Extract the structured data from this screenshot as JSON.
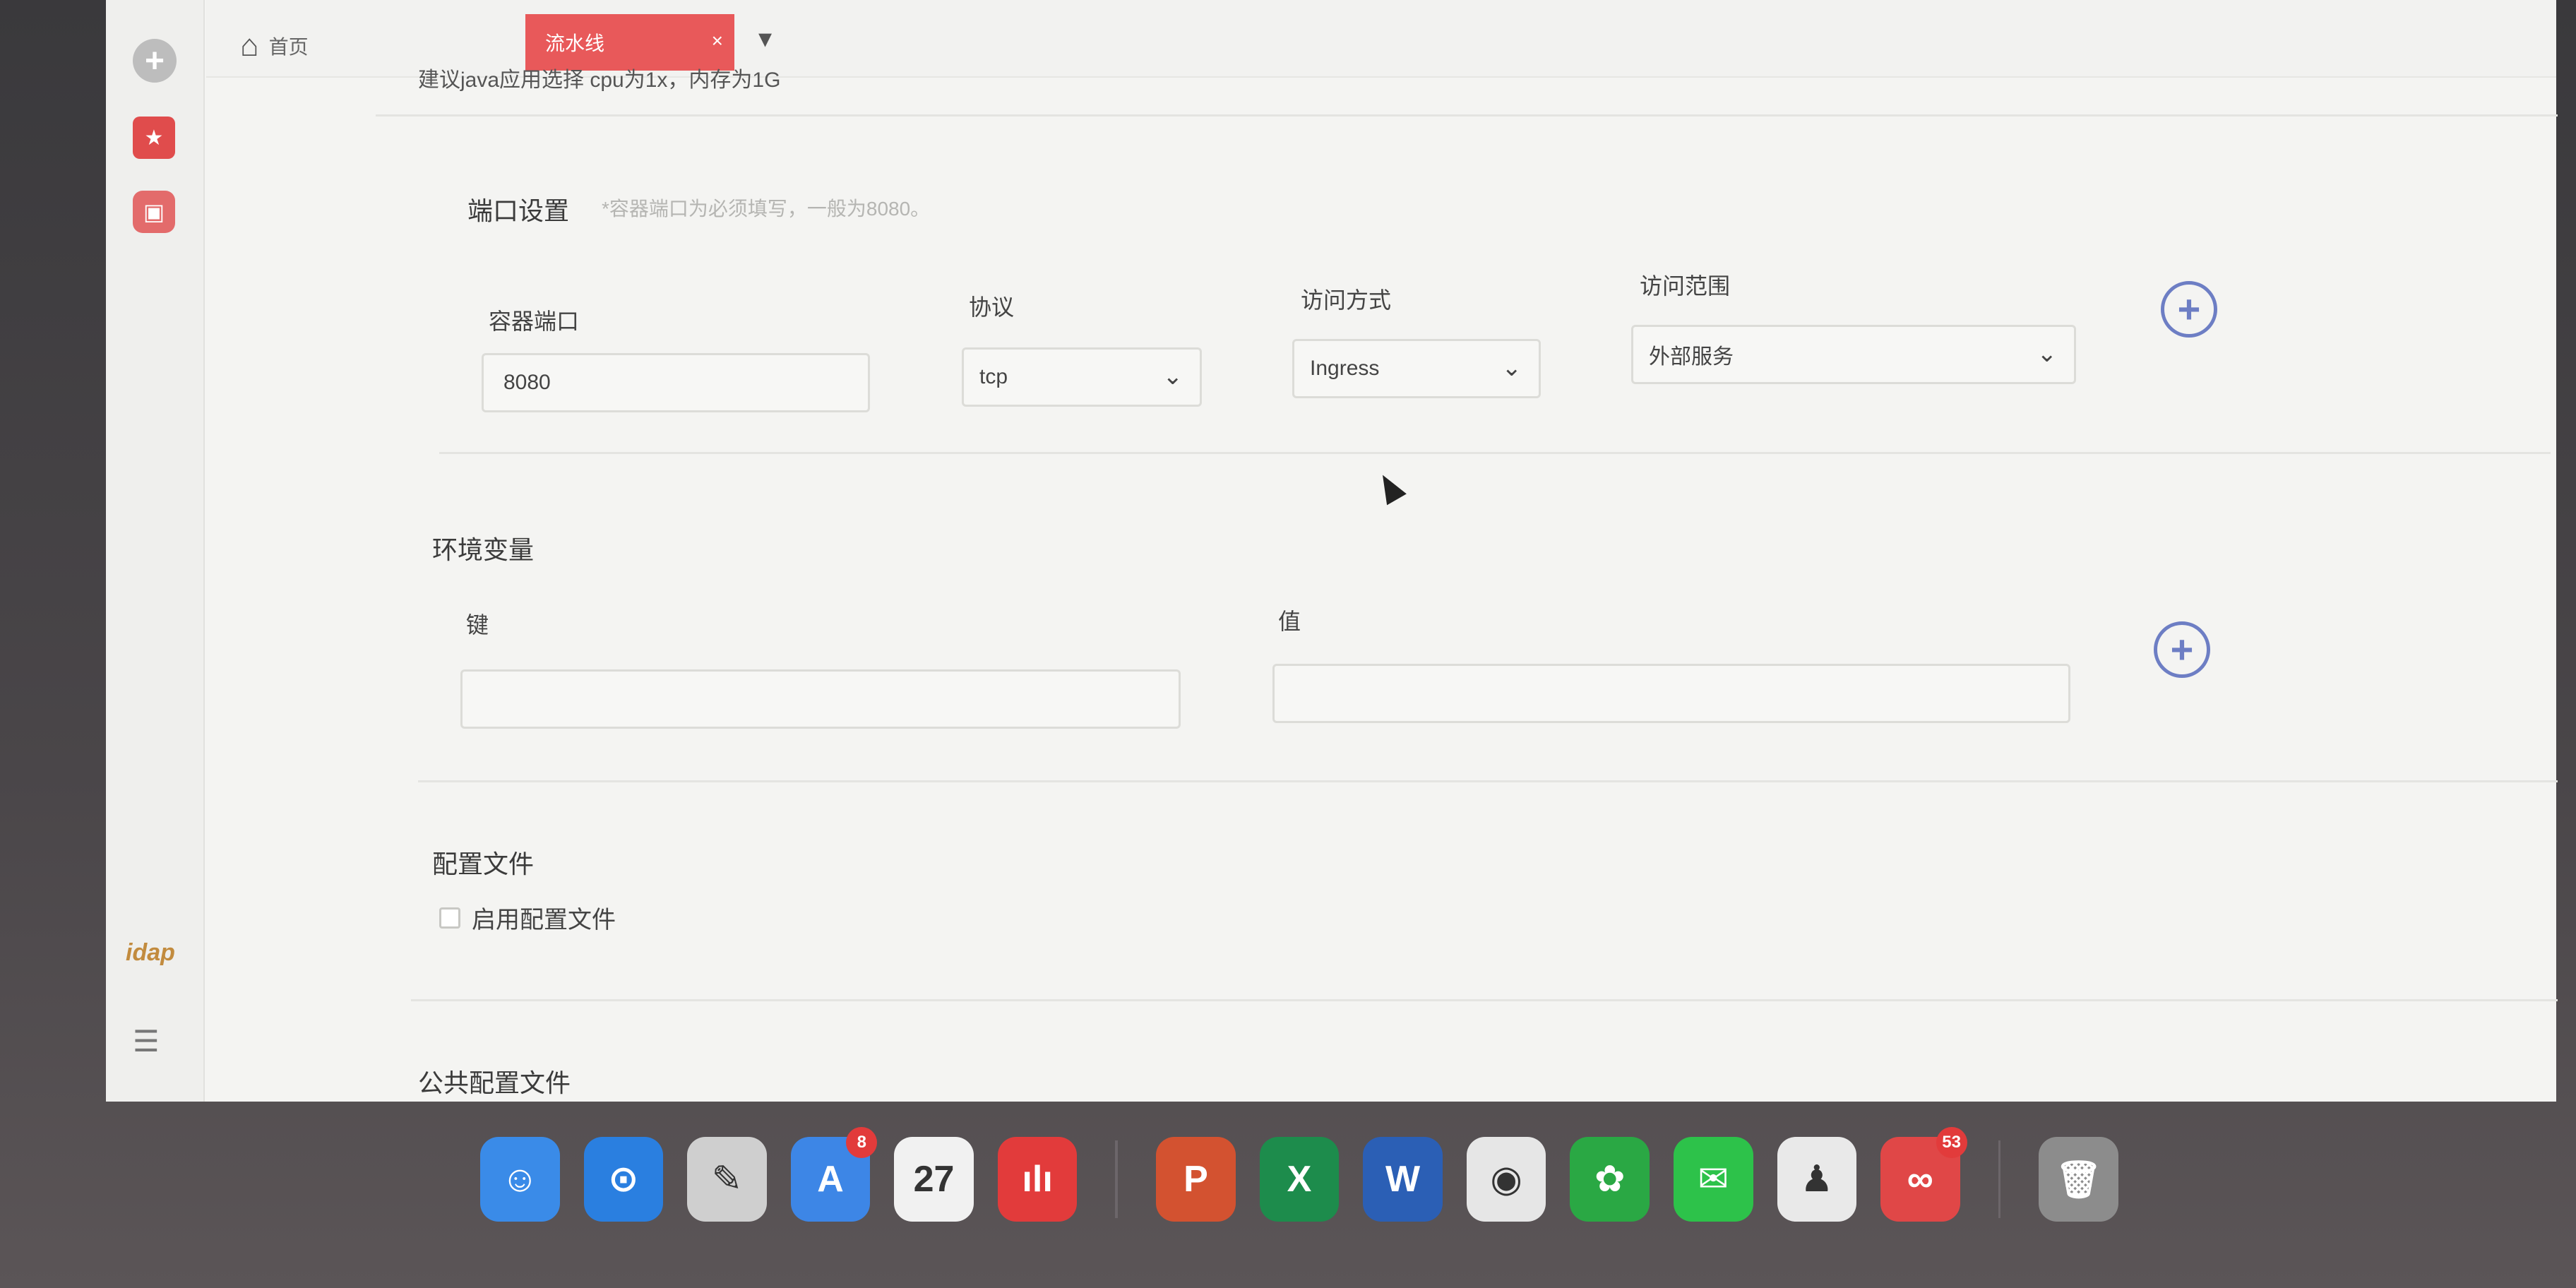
{
  "tabs": {
    "home_label": "首页",
    "active_label": "流水线",
    "close_glyph": "×"
  },
  "note": "建议java应用选择 cpu为1x，内存为1G",
  "ports": {
    "title": "端口设置",
    "hint": "*容器端口为必须填写，一般为8080。",
    "container_port_label": "容器端口",
    "container_port_value": "8080",
    "protocol_label": "协议",
    "protocol_value": "tcp",
    "access_method_label": "访问方式",
    "access_method_value": "Ingress",
    "access_scope_label": "访问范围",
    "access_scope_value": "外部服务"
  },
  "env": {
    "title": "环境变量",
    "key_label": "键",
    "value_label": "值",
    "key_value": "",
    "value_value": ""
  },
  "config": {
    "title": "配置文件",
    "enable_label": "启用配置文件",
    "enabled": false
  },
  "public_config": {
    "title": "公共配置文件"
  },
  "dock": {
    "items": [
      {
        "name": "finder",
        "glyph": "☺",
        "color": "#3a8be8"
      },
      {
        "name": "safari",
        "glyph": "⊙",
        "color": "#2a7fe0"
      },
      {
        "name": "notes",
        "glyph": "✎",
        "color": "#cfcfcf"
      },
      {
        "name": "app-store",
        "glyph": "A",
        "color": "#3d86e6",
        "badge": "8"
      },
      {
        "name": "calendar",
        "glyph": "27",
        "color": "#f1f1f1"
      },
      {
        "name": "music",
        "glyph": "ılı",
        "color": "#e23b3b"
      },
      {
        "name": "powerpoint",
        "glyph": "P",
        "color": "#d35230"
      },
      {
        "name": "excel",
        "glyph": "X",
        "color": "#1d8c4c"
      },
      {
        "name": "word",
        "glyph": "W",
        "color": "#2b5fb5"
      },
      {
        "name": "chrome",
        "glyph": "◉",
        "color": "#e6e6e6"
      },
      {
        "name": "evernote",
        "glyph": "✿",
        "color": "#2aa844"
      },
      {
        "name": "wechat",
        "glyph": "✉",
        "color": "#2dc24a"
      },
      {
        "name": "qq",
        "glyph": "♟",
        "color": "#e9e9e9"
      },
      {
        "name": "link-app",
        "glyph": "∞",
        "color": "#e04747",
        "badge": "53"
      },
      {
        "name": "trash",
        "glyph": "🗑",
        "color": "#8c8c8c"
      }
    ]
  }
}
